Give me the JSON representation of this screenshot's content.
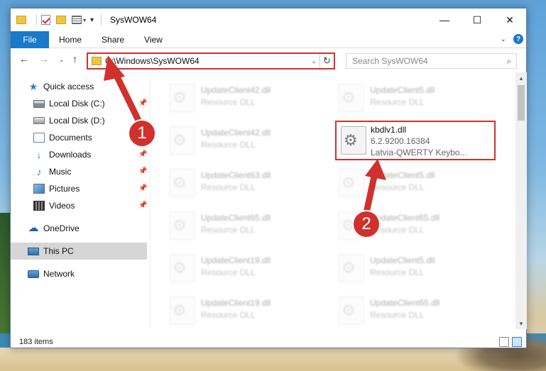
{
  "window": {
    "title": "SysWOW64",
    "controls": {
      "minimize": "—",
      "maximize": "☐",
      "close": "✕"
    }
  },
  "ribbon": {
    "tabs": [
      "File",
      "Home",
      "Share",
      "View"
    ],
    "collapse_icon": "⌄",
    "help_label": "?"
  },
  "nav": {
    "back": "←",
    "forward": "→",
    "recent": "⌄",
    "up": "↑",
    "address": "C:\\Windows\\SysWOW64",
    "address_dropdown": "⌄",
    "refresh": "↻",
    "search_placeholder": "Search SysWOW64",
    "search_icon": "⌕"
  },
  "sidebar": {
    "pin_glyph": "📌",
    "items": [
      {
        "label": "Quick access",
        "icon": "star-icon"
      },
      {
        "label": "Local Disk (C:)",
        "icon": "drive-c-icon",
        "pinned": true
      },
      {
        "label": "Local Disk (D:)",
        "icon": "drive-icon"
      },
      {
        "label": "Documents",
        "icon": "documents-icon",
        "pinned": true
      },
      {
        "label": "Downloads",
        "icon": "download-icon",
        "pinned": true
      },
      {
        "label": "Music",
        "icon": "music-icon",
        "pinned": true
      },
      {
        "label": "Pictures",
        "icon": "pictures-icon",
        "pinned": true
      },
      {
        "label": "Videos",
        "icon": "videos-icon",
        "pinned": true
      },
      {
        "label": "OneDrive",
        "icon": "onedrive-icon"
      },
      {
        "label": "This PC",
        "icon": "pc-icon",
        "selected": true
      },
      {
        "label": "Network",
        "icon": "network-icon"
      }
    ]
  },
  "files": {
    "col1": [
      {
        "name": "UpdateClient42.dll",
        "desc": "Resource DLL"
      },
      {
        "name": "UpdateClient42.dll",
        "desc": "Resource DLL"
      },
      {
        "name": "UpdateClient63.dll",
        "desc": "Resource DLL"
      },
      {
        "name": "UpdateClient65.dll",
        "desc": "Resource DLL"
      },
      {
        "name": "UpdateClient19.dll",
        "desc": "Resource DLL"
      },
      {
        "name": "UpdateClient19.dll",
        "desc": "Resource DLL"
      }
    ],
    "col2": [
      {
        "name": "UpdateClient5.dll",
        "desc": "Resource DLL"
      },
      {
        "name": "UpdateClient5.dll",
        "desc": "Resource DLL"
      },
      {
        "name": "UpdateClient65.dll",
        "desc": "Resource DLL"
      },
      {
        "name": "UpdateClient5.dll",
        "desc": "Resource DLL"
      },
      {
        "name": "UpdateClient65.dll",
        "desc": "Resource DLL"
      }
    ],
    "highlighted": {
      "name": "kbdlv1.dll",
      "version": "6.2.9200.16384",
      "desc": "Latvia-QWERTY Keybo..."
    }
  },
  "status": {
    "item_count": "183 items"
  },
  "annotations": {
    "step1": "1",
    "step2": "2",
    "color": "#d0312d"
  }
}
